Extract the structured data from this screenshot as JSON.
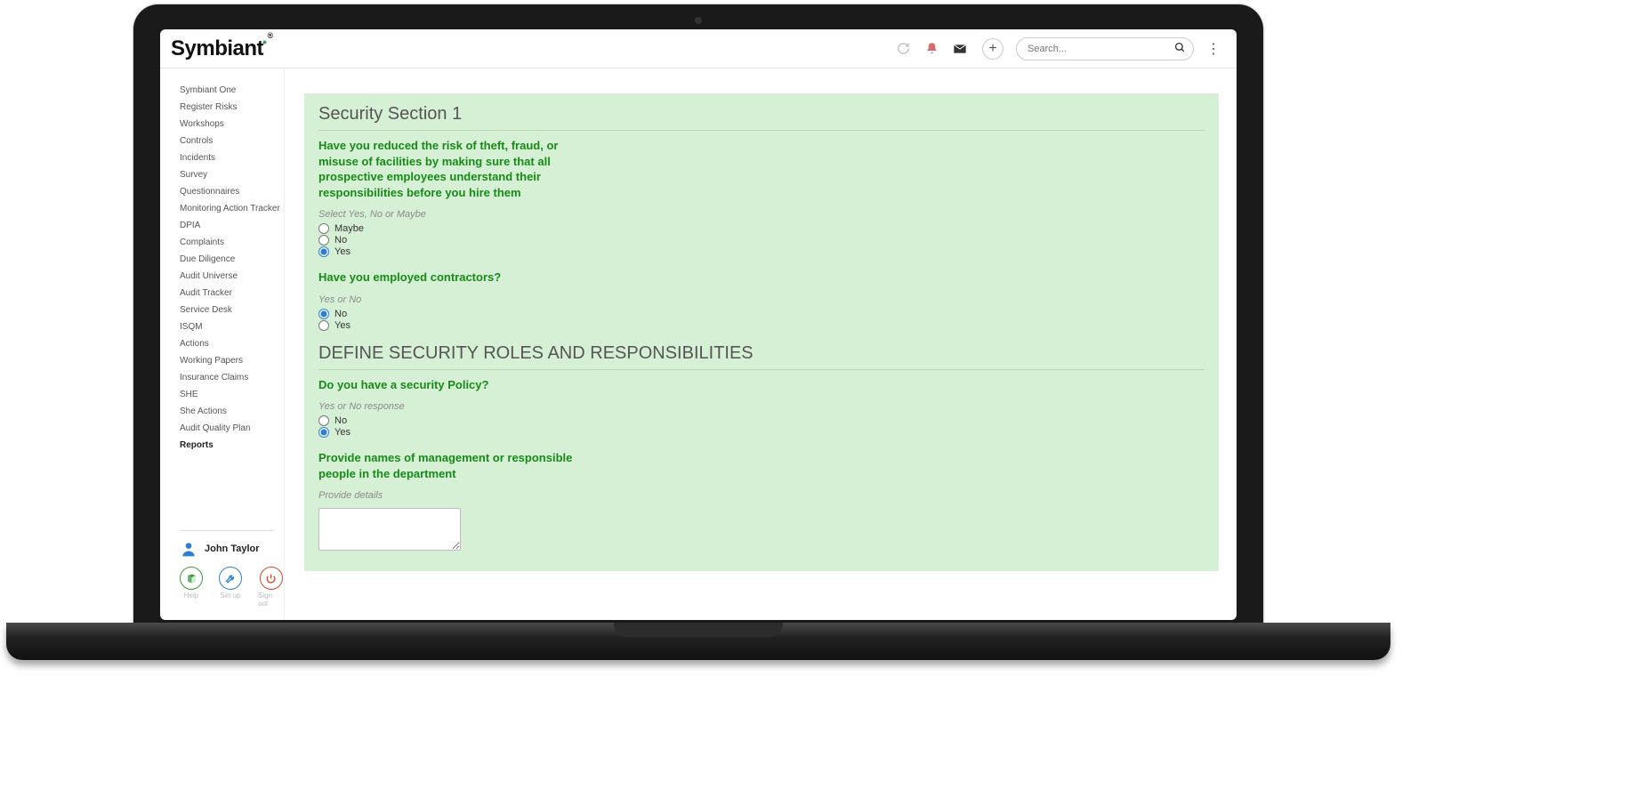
{
  "brand": "Symbiant",
  "search": {
    "placeholder": "Search..."
  },
  "sidebar": {
    "items": [
      {
        "label": "Symbiant One"
      },
      {
        "label": "Register Risks"
      },
      {
        "label": "Workshops"
      },
      {
        "label": "Controls"
      },
      {
        "label": "Incidents"
      },
      {
        "label": "Survey"
      },
      {
        "label": "Questionnaires"
      },
      {
        "label": "Monitoring Action Tracker"
      },
      {
        "label": "DPIA"
      },
      {
        "label": "Complaints"
      },
      {
        "label": "Due Diligence"
      },
      {
        "label": "Audit Universe"
      },
      {
        "label": "Audit Tracker"
      },
      {
        "label": "Service Desk"
      },
      {
        "label": "ISQM"
      },
      {
        "label": "Actions"
      },
      {
        "label": "Working Papers"
      },
      {
        "label": "Insurance Claims"
      },
      {
        "label": "SHE"
      },
      {
        "label": "She Actions"
      },
      {
        "label": "Audit Quality Plan"
      },
      {
        "label": "Reports",
        "active": true
      }
    ],
    "user": "John Taylor",
    "help_label": "Help",
    "setup_label": "Set up",
    "signout_label": "Sign out"
  },
  "form": {
    "section1_title": "Security Section 1",
    "q1": "Have you reduced the risk of theft, fraud, or misuse of facilities by making sure that all prospective employees understand their responsibilities before you hire them",
    "q1_hint": "Select Yes, No or Maybe",
    "q1_options": [
      "Maybe",
      "No",
      "Yes"
    ],
    "q1_selected": "Yes",
    "q2": "Have you employed contractors?",
    "q2_hint": "Yes or No",
    "q2_options": [
      "No",
      "Yes"
    ],
    "q2_selected": "No",
    "section2_title": "DEFINE SECURITY ROLES AND RESPONSIBILITIES",
    "q3": "Do you have a security Policy?",
    "q3_hint": "Yes or No response",
    "q3_options": [
      "No",
      "Yes"
    ],
    "q3_selected": "Yes",
    "q4": "Provide names of management or responsible people in the department",
    "q4_hint": "Provide details",
    "q4_value": ""
  }
}
